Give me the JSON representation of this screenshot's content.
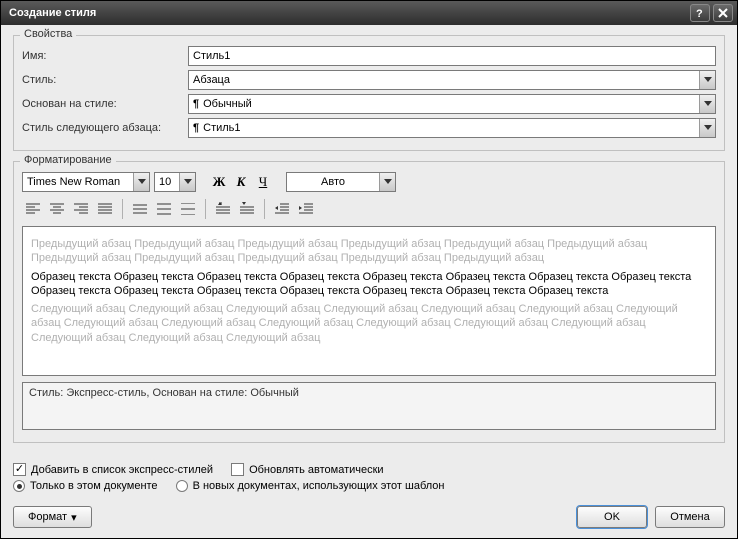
{
  "window": {
    "title": "Создание стиля"
  },
  "properties": {
    "legend": "Свойства",
    "name_label": "Имя:",
    "name_value": "Стиль1",
    "style_label": "Стиль:",
    "style_value": "Абзаца",
    "based_label": "Основан на стиле:",
    "based_value": "Обычный",
    "next_label": "Стиль следующего абзаца:",
    "next_value": "Стиль1"
  },
  "formatting": {
    "legend": "Форматирование",
    "font": "Times New Roman",
    "size": "10",
    "bold": "Ж",
    "italic": "К",
    "underline": "Ч",
    "color": "Авто"
  },
  "preview": {
    "prev_line": "Предыдущий абзац Предыдущий абзац Предыдущий абзац Предыдущий абзац Предыдущий абзац Предыдущий абзац Предыдущий абзац Предыдущий абзац Предыдущий абзац Предыдущий абзац Предыдущий абзац",
    "sample": "Образец текста Образец текста Образец текста Образец текста Образец текста Образец текста Образец текста Образец текста Образец текста Образец текста Образец текста Образец текста Образец текста Образец текста Образец текста",
    "next_line": "Следующий абзац Следующий абзац Следующий абзац Следующий абзац Следующий абзац Следующий абзац Следующий абзац Следующий абзац Следующий абзац Следующий абзац Следующий абзац Следующий абзац Следующий абзац Следующий абзац Следующий абзац Следующий абзац"
  },
  "description": "Стиль: Экспресс-стиль, Основан на стиле: Обычный",
  "opts": {
    "express_label": "Добавить в список экспресс-стилей",
    "auto_update_label": "Обновлять автоматически",
    "only_doc_label": "Только в этом документе",
    "new_docs_label": "В новых документах, использующих этот шаблон"
  },
  "buttons": {
    "format": "Формат",
    "ok": "OK",
    "cancel": "Отмена"
  }
}
